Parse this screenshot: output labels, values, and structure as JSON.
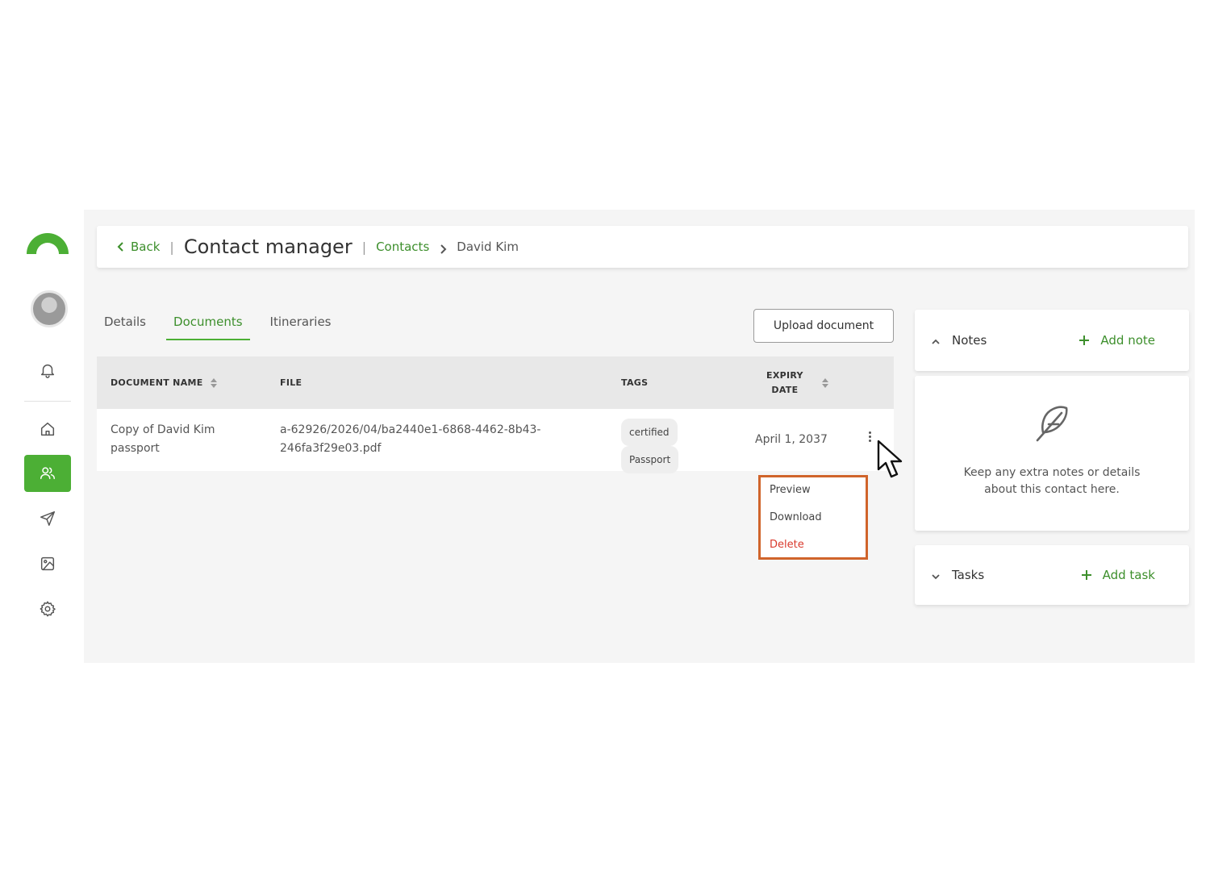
{
  "header": {
    "back_label": "Back",
    "separator": "|",
    "title": "Contact manager",
    "breadcrumb": {
      "link": "Contacts",
      "current": "David Kim"
    }
  },
  "tabs": [
    {
      "label": "Details",
      "active": false
    },
    {
      "label": "Documents",
      "active": true
    },
    {
      "label": "Itineraries",
      "active": false
    }
  ],
  "upload_button": "Upload document",
  "table": {
    "columns": {
      "name": "DOCUMENT NAME",
      "file": "FILE",
      "tags": "TAGS",
      "expiry_line1": "EXPIRY",
      "expiry_line2": "DATE"
    },
    "rows": [
      {
        "name_line1": "Copy of David Kim",
        "name_line2": "passport",
        "file_line1": "a-62926/2026/04/ba2440e1-6868-4462-8b43-",
        "file_line2": "246fa3f29e03.pdf",
        "tags": [
          "certified",
          "Passport"
        ],
        "expiry": "April 1, 2037"
      }
    ]
  },
  "row_menu": {
    "preview": "Preview",
    "download": "Download",
    "delete": "Delete"
  },
  "notes": {
    "title": "Notes",
    "add_label": "Add note",
    "empty_line1": "Keep any extra notes or details",
    "empty_line2": "about this contact here."
  },
  "tasks": {
    "title": "Tasks",
    "add_label": "Add task"
  },
  "colors": {
    "accent": "#4caf35",
    "accent_text": "#3d8f2c",
    "danger": "#d9392c",
    "highlight_border": "#d0642b"
  },
  "icons": [
    "logo-arc-icon",
    "bell-icon",
    "home-icon",
    "users-icon",
    "send-icon",
    "image-icon",
    "gear-icon",
    "feather-icon",
    "chevron-left-icon",
    "chevron-right-icon",
    "plus-icon",
    "kebab-icon",
    "cursor-arrow-icon"
  ]
}
